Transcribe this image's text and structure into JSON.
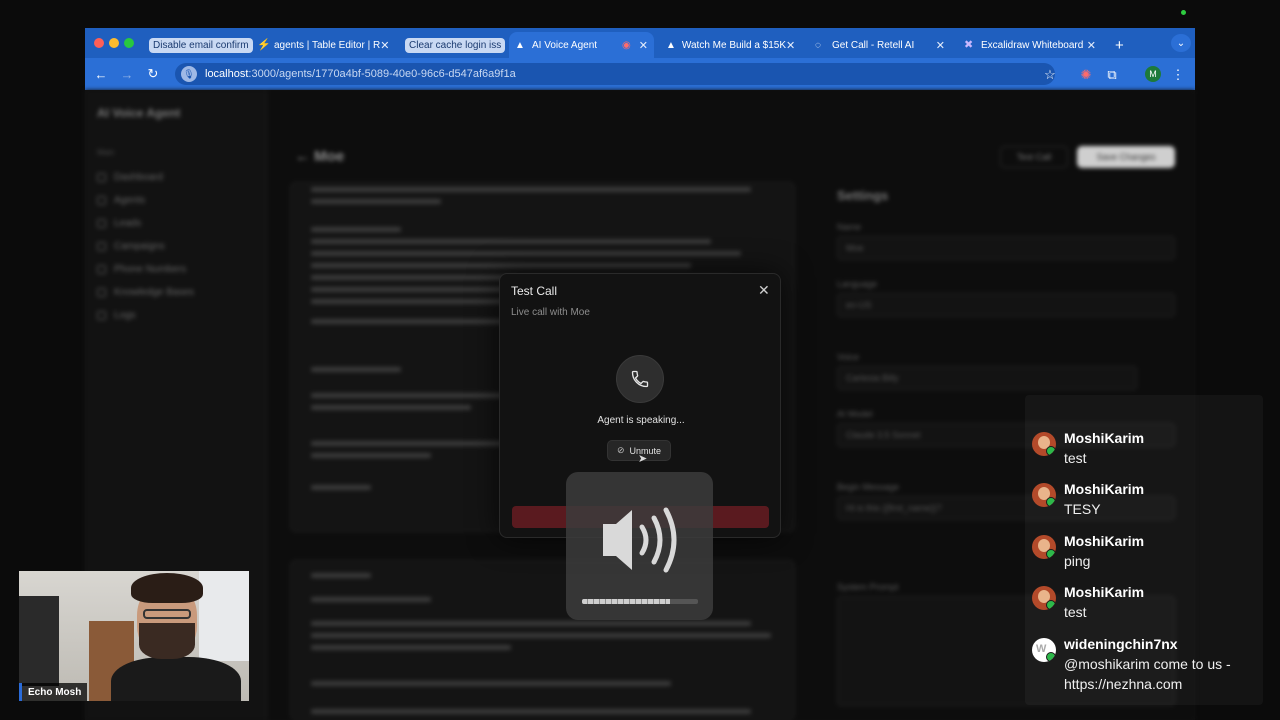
{
  "browser": {
    "tabs": [
      {
        "label": "Disable email confirm",
        "style": "pill"
      },
      {
        "label": "agents | Table Editor | R",
        "style": "normal"
      },
      {
        "label": "Clear cache login iss",
        "style": "pill"
      },
      {
        "label": "AI Voice Agent",
        "style": "active"
      },
      {
        "label": "Watch Me Build a $15K",
        "style": "normal"
      },
      {
        "label": "Get Call - Retell AI",
        "style": "normal"
      },
      {
        "label": "Excalidraw Whiteboard",
        "style": "normal"
      }
    ],
    "url_host": "localhost",
    "url_path": ":3000/agents/1770a4bf-5089-40e0-96c6-d547af6a9f1a",
    "profile_initial": "M"
  },
  "app": {
    "title": "AI Voice Agent",
    "section": "Main",
    "nav": [
      "Dashboard",
      "Agents",
      "Leads",
      "Campaigns",
      "Phone Numbers",
      "Knowledge Bases",
      "Logs"
    ],
    "agent_name": "Moe",
    "test_call_btn": "Test Call",
    "save_btn": "Save Changes",
    "settings_title": "Settings",
    "settings_fields": [
      {
        "label": "Name",
        "value": "Moe"
      },
      {
        "label": "Language",
        "value": "en-US"
      },
      {
        "label": "Voice",
        "value": "Cartesia Billy"
      },
      {
        "label": "AI Model",
        "value": "Claude 3.5 Sonnet"
      },
      {
        "label": "Begin Message",
        "value": "Hi is this {{first_name}}?"
      },
      {
        "label": "System Prompt",
        "value": ""
      }
    ]
  },
  "modal": {
    "title": "Test Call",
    "subtitle": "Live call with Moe",
    "status": "Agent is speaking...",
    "unmute_label": "Unmute"
  },
  "volume": {
    "level": 0.76
  },
  "chat": [
    {
      "user": "MoshiKarim",
      "text": "test",
      "avatar": "photo"
    },
    {
      "user": "MoshiKarim",
      "text": "TESY",
      "avatar": "photo"
    },
    {
      "user": "MoshiKarim",
      "text": "ping",
      "avatar": "photo"
    },
    {
      "user": "MoshiKarim",
      "text": "test",
      "avatar": "photo"
    },
    {
      "user": "wideningchin7nx",
      "text": "@moshikarim come to us -",
      "text2": "https://nezhna.com",
      "avatar": "letter",
      "avatar_letter": "W"
    }
  ],
  "webcam": {
    "label": "Echo Mosh"
  },
  "colors": {
    "tab_strip": "#1f5fbf",
    "address_bar": "#2b6fd6",
    "end_call": "#5a1a1f",
    "badge": "#2db84a"
  }
}
